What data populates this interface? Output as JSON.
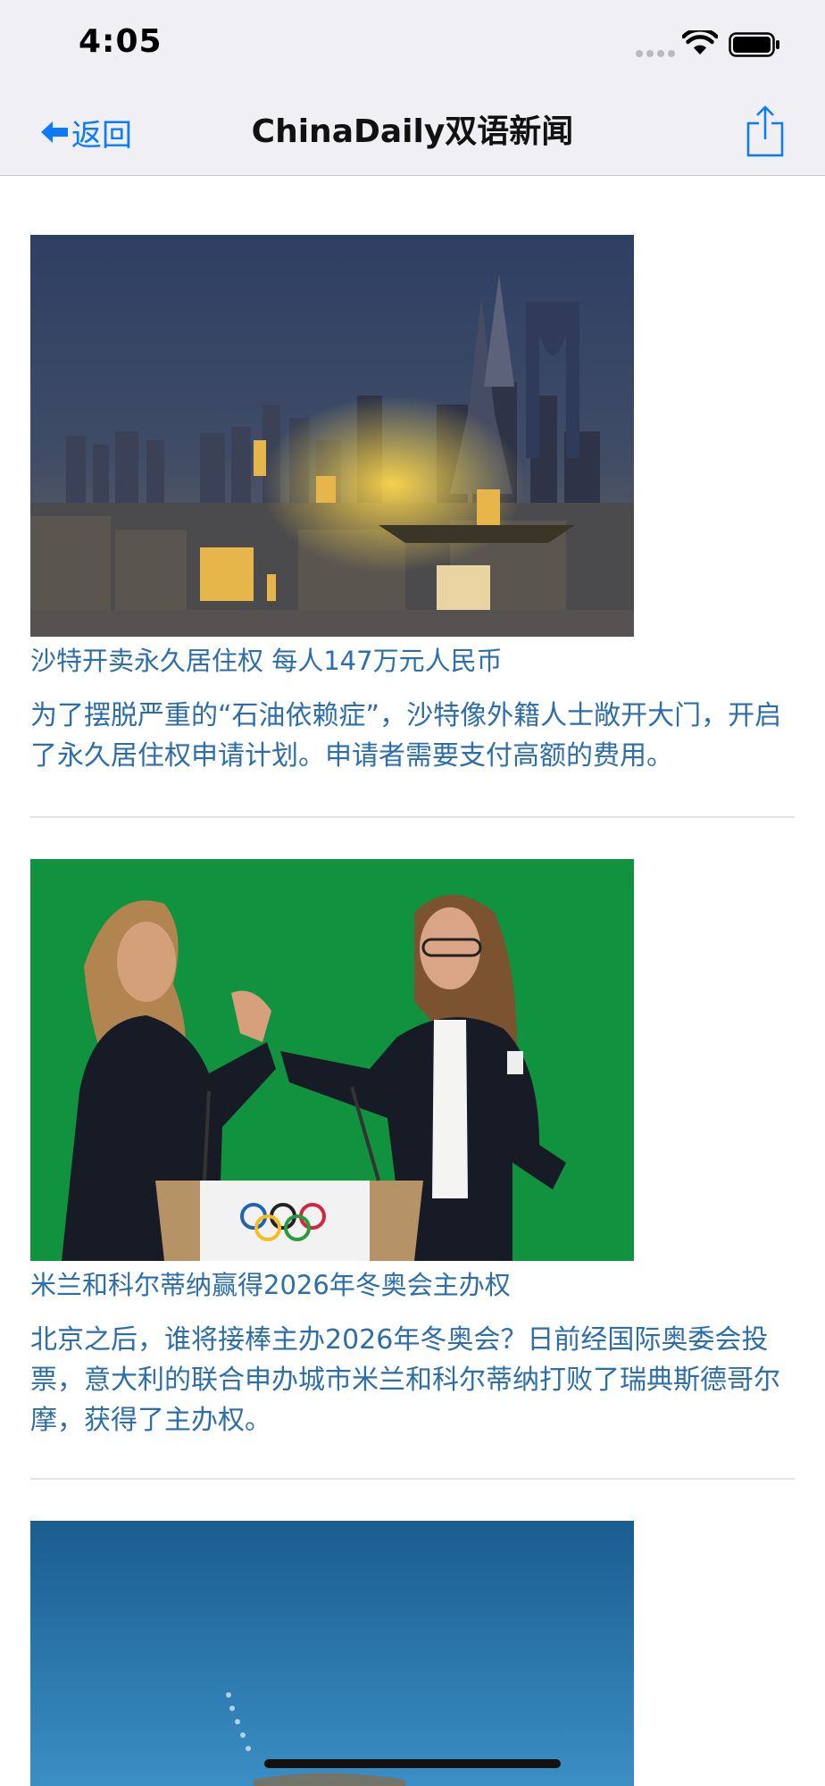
{
  "status_bar": {
    "time": "4:05",
    "signal_icon": "cellular-signal-icon",
    "wifi_icon": "wifi-icon",
    "battery_icon": "battery-icon"
  },
  "nav": {
    "back_label": "返回",
    "back_icon": "left-arrow-icon",
    "title": "ChinaDaily双语新闻",
    "share_icon": "share-icon"
  },
  "colors": {
    "accent": "#0a7aff",
    "link_text": "#2d6ea8",
    "chrome_bg": "#efeff4"
  },
  "articles": [
    {
      "image": "riyadh-skyline-photo",
      "headline": "沙特开卖永久居住权 每人147万元人民币",
      "summary": "为了摆脱严重的“石油依赖症”，沙特像外籍人士敞开大门，开启了永久居住权申请计划。申请者需要支付高额的费用。"
    },
    {
      "image": "olympic-handshake-photo",
      "headline": "米兰和科尔蒂纳赢得2026年冬奥会主办权",
      "summary": "北京之后，谁将接棒主办2026年冬奥会？日前经国际奥委会投票，意大利的联合申办城市米兰和科尔蒂纳打败了瑞典斯德哥尔摩，获得了主办权。"
    },
    {
      "image": "mosquito-blue-photo"
    }
  ]
}
